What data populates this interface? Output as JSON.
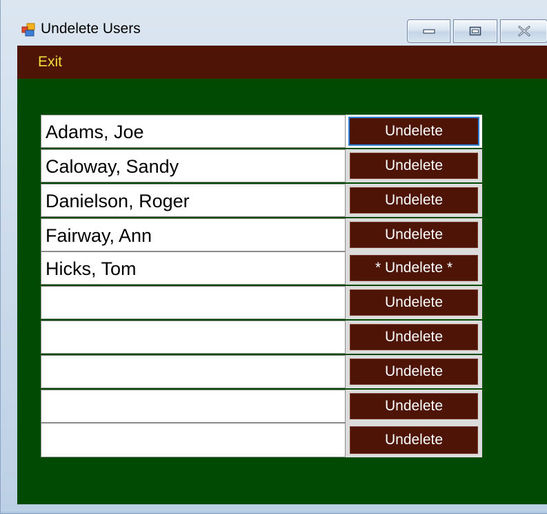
{
  "window": {
    "title": "Undelete Users",
    "icon": "windows-form-icon"
  },
  "titlebar_buttons": {
    "minimize_icon": "minimize-icon",
    "maximize_icon": "maximize-icon",
    "close_icon": "close-icon"
  },
  "menu": {
    "exit_label": "Exit"
  },
  "colors": {
    "menubar_bg": "#4e1406",
    "menu_text": "#f3df3a",
    "client_bg": "#004a04",
    "button_bg": "#4e1406",
    "button_text": "#ffffff",
    "focus_border": "#2f7fd3"
  },
  "rows": [
    {
      "name": "Adams, Joe",
      "button_label": "Undelete"
    },
    {
      "name": "Caloway, Sandy",
      "button_label": "Undelete"
    },
    {
      "name": "Danielson, Roger",
      "button_label": "Undelete"
    },
    {
      "name": "Fairway, Ann",
      "button_label": "Undelete"
    },
    {
      "name": "Hicks, Tom",
      "button_label": "* Undelete *"
    },
    {
      "name": "",
      "button_label": "Undelete"
    },
    {
      "name": "",
      "button_label": "Undelete"
    },
    {
      "name": "",
      "button_label": "Undelete"
    },
    {
      "name": "",
      "button_label": "Undelete"
    },
    {
      "name": "",
      "button_label": "Undelete"
    }
  ]
}
